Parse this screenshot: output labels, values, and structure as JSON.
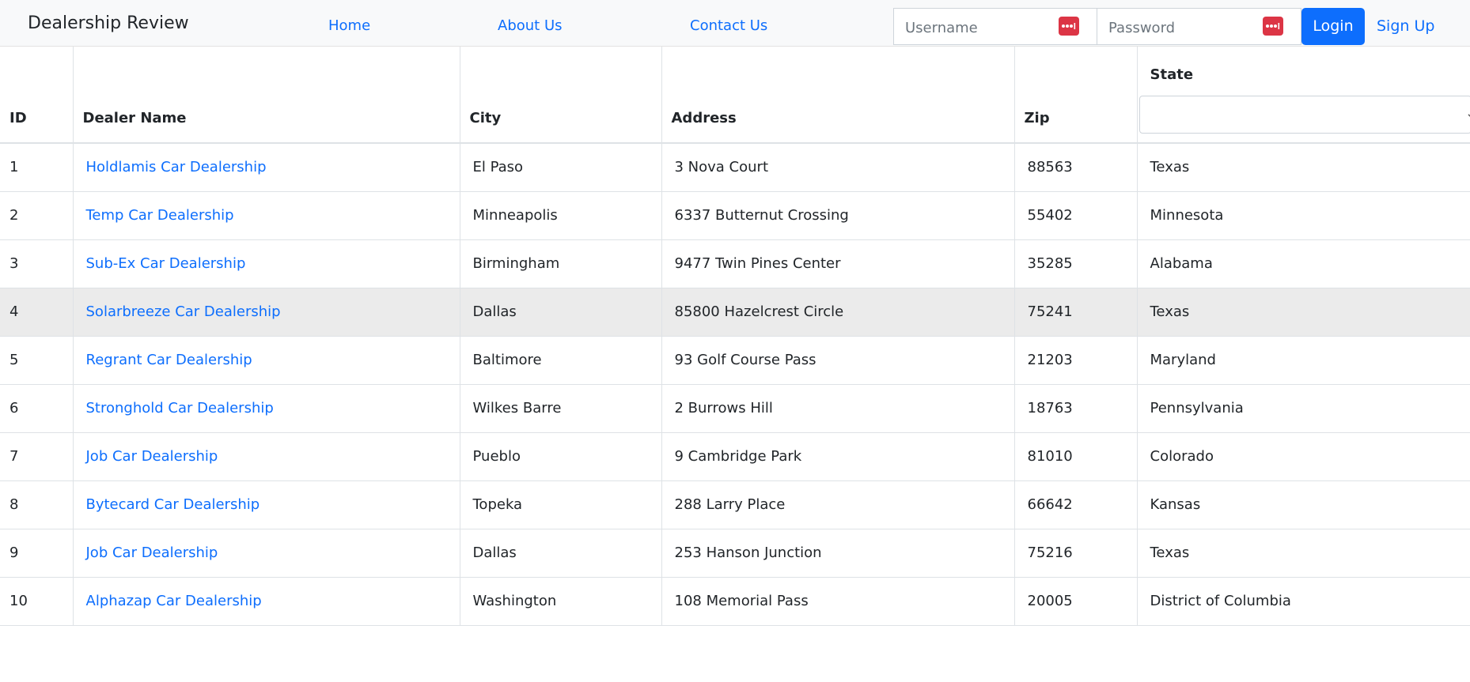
{
  "navbar": {
    "brand": "Dealership Review",
    "links": [
      "Home",
      "About Us",
      "Contact Us"
    ],
    "username_placeholder": "Username",
    "password_placeholder": "Password",
    "login_label": "Login",
    "signup_label": "Sign Up",
    "icon_color": "#dc3545"
  },
  "colors": {
    "accent": "#0d6efd",
    "navbar_bg": "#f8f9fa",
    "highlight_row": "#ebebeb"
  },
  "table": {
    "headers": [
      "ID",
      "Dealer Name",
      "City",
      "Address",
      "Zip",
      "State"
    ],
    "state_filter_value": "",
    "highlighted_row_id": "4",
    "rows": [
      {
        "id": "1",
        "name": "Holdlamis Car Dealership",
        "city": "El Paso",
        "address": "3 Nova Court",
        "zip": "88563",
        "state": "Texas"
      },
      {
        "id": "2",
        "name": "Temp Car Dealership",
        "city": "Minneapolis",
        "address": "6337 Butternut Crossing",
        "zip": "55402",
        "state": "Minnesota"
      },
      {
        "id": "3",
        "name": "Sub-Ex Car Dealership",
        "city": "Birmingham",
        "address": "9477 Twin Pines Center",
        "zip": "35285",
        "state": "Alabama"
      },
      {
        "id": "4",
        "name": "Solarbreeze Car Dealership",
        "city": "Dallas",
        "address": "85800 Hazelcrest Circle",
        "zip": "75241",
        "state": "Texas"
      },
      {
        "id": "5",
        "name": "Regrant Car Dealership",
        "city": "Baltimore",
        "address": "93 Golf Course Pass",
        "zip": "21203",
        "state": "Maryland"
      },
      {
        "id": "6",
        "name": "Stronghold Car Dealership",
        "city": "Wilkes Barre",
        "address": "2 Burrows Hill",
        "zip": "18763",
        "state": "Pennsylvania"
      },
      {
        "id": "7",
        "name": "Job Car Dealership",
        "city": "Pueblo",
        "address": "9 Cambridge Park",
        "zip": "81010",
        "state": "Colorado"
      },
      {
        "id": "8",
        "name": "Bytecard Car Dealership",
        "city": "Topeka",
        "address": "288 Larry Place",
        "zip": "66642",
        "state": "Kansas"
      },
      {
        "id": "9",
        "name": "Job Car Dealership",
        "city": "Dallas",
        "address": "253 Hanson Junction",
        "zip": "75216",
        "state": "Texas"
      },
      {
        "id": "10",
        "name": "Alphazap Car Dealership",
        "city": "Washington",
        "address": "108 Memorial Pass",
        "zip": "20005",
        "state": "District of Columbia"
      }
    ]
  }
}
